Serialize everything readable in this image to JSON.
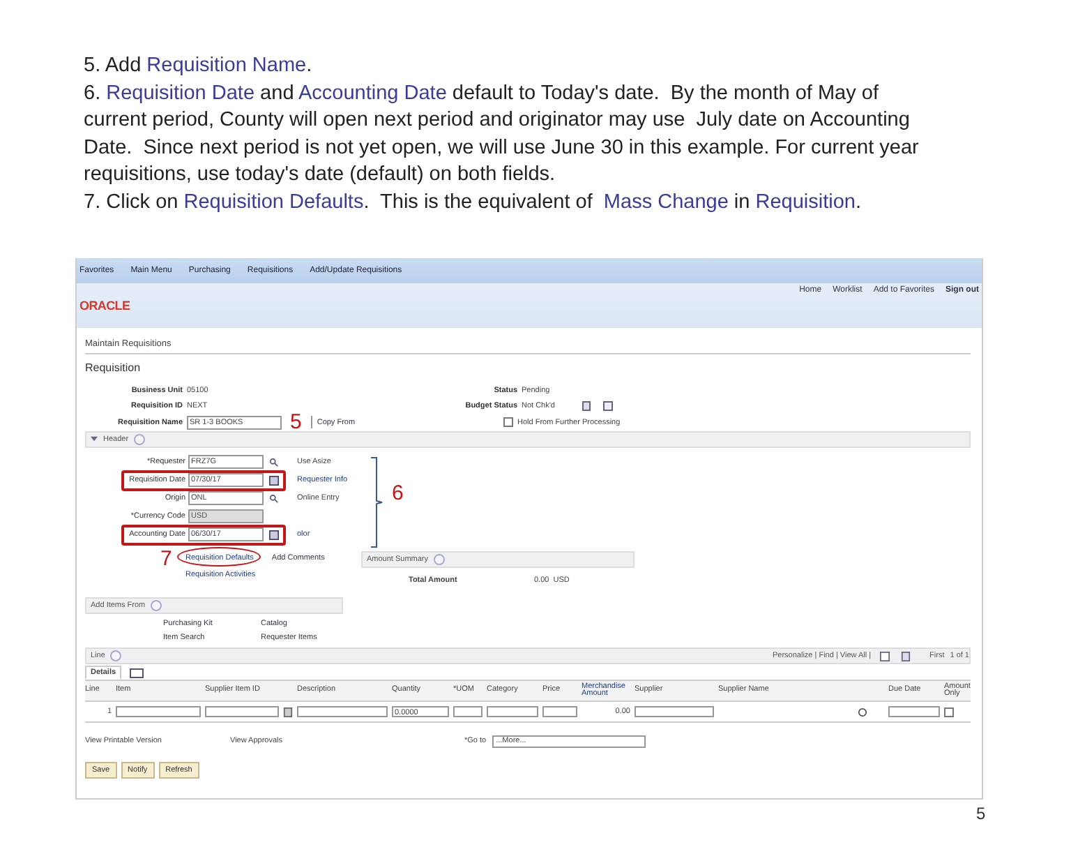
{
  "instructions": [
    {
      "number": "5.",
      "parts": [
        {
          "text": "Add ",
          "highlight": false
        },
        {
          "text": "Requisition Name",
          "highlight": true
        },
        {
          "text": ".",
          "highlight": false
        }
      ]
    },
    {
      "number": "6.",
      "parts": [
        {
          "text": "Requisition Date",
          "highlight": true
        },
        {
          "text": " and ",
          "highlight": false
        },
        {
          "text": "Accounting Date",
          "highlight": true
        },
        {
          "text": " default to Today's date.  By the month of May of current period, County will open next period and originator may use  July date on Accounting Date.  Since next period is not yet open, we will use June 30 in this example. For current year requisitions, use today's date (default) on both fields.",
          "highlight": false
        }
      ]
    },
    {
      "number": "7.",
      "parts": [
        {
          "text": "Click on ",
          "highlight": false
        },
        {
          "text": "Requisition Defaults",
          "highlight": true
        },
        {
          "text": ".  This is the equivalent of  ",
          "highlight": false
        },
        {
          "text": "Mass Change",
          "highlight": true
        },
        {
          "text": " in ",
          "highlight": false
        },
        {
          "text": "Requisition",
          "highlight": true
        },
        {
          "text": ".",
          "highlight": false
        }
      ]
    }
  ],
  "screen": {
    "breadcrumb": [
      "Favorites",
      "Main Menu",
      "Purchasing",
      "Requisitions",
      "Add/Update Requisitions"
    ],
    "logo": "ORACLE",
    "top_links": [
      "Home",
      "Worklist",
      "Add to Favorites",
      "Sign out"
    ],
    "page_label": "Maintain Requisitions",
    "page_title": "Requisition",
    "info_fields": [
      {
        "label": "Business Unit",
        "value": "05100"
      },
      {
        "label": "Requisition ID",
        "value": "NEXT"
      }
    ],
    "name_field": {
      "label": "Requisition Name",
      "value": "SR 1-3 BOOKS"
    },
    "copy_from": "Copy From",
    "status_fields": [
      {
        "label": "Status",
        "value": "Pending"
      },
      {
        "label": "Budget Status",
        "value": "Not Chk'd"
      }
    ],
    "hold_checkbox": {
      "label": "Hold From Further Processing",
      "checked": false
    },
    "header_section": {
      "title": "Header",
      "expanded": true
    },
    "header_fields": [
      {
        "label": "*Requester",
        "value": "FRZ7G",
        "kind": "lookup",
        "disabled": false,
        "highlighted": false,
        "side": "Use Asize"
      },
      {
        "label": "Requisition Date",
        "value": "07/30/17",
        "kind": "date",
        "disabled": false,
        "highlighted": true,
        "side": "Requester Info"
      },
      {
        "label": "Origin",
        "value": "ONL",
        "kind": "lookup",
        "disabled": false,
        "highlighted": false,
        "side": "Online Entry"
      },
      {
        "label": "*Currency Code",
        "value": "USD",
        "kind": "plain",
        "disabled": true,
        "highlighted": false
      },
      {
        "label": "Accounting Date",
        "value": "06/30/17",
        "kind": "date",
        "disabled": false,
        "highlighted": true,
        "side": "olor"
      }
    ],
    "default_links": [
      "Requisition Defaults",
      "Requisition Activities"
    ],
    "add_comments": "Add Comments",
    "amount_summary": {
      "title": "Amount Summary",
      "label": "Total Amount",
      "value": "0.00",
      "currency": "USD"
    },
    "add_items": {
      "title": "Add Items From",
      "links": [
        "Purchasing Kit",
        "Catalog",
        "Item Search",
        "Requester Items"
      ]
    },
    "line_section": {
      "title": "Line",
      "nav": "Personalize | Find | View All |",
      "paging": "First",
      "count": "1 of 1"
    },
    "tabs": [
      {
        "label": "Details",
        "selected": true
      }
    ],
    "columns": [
      "Line",
      "Item",
      "Supplier Item ID",
      "",
      "Description",
      "Quantity",
      "*UOM",
      "Category",
      "Price",
      "Merchandise Amount",
      "Supplier",
      "Supplier Name",
      "",
      "Due Date",
      "Amount Only"
    ],
    "row": {
      "line": "1",
      "quantity": "0.0000",
      "amount": "0.00",
      "amount_only": false
    },
    "footer_links": [
      "View Printable Version",
      "View Approvals"
    ],
    "goto": {
      "label": "*Go to",
      "value": "...More..."
    },
    "buttons": [
      "Save",
      "Notify",
      "Refresh"
    ]
  },
  "callouts": [
    "5",
    "6",
    "7"
  ],
  "page_number": "5"
}
